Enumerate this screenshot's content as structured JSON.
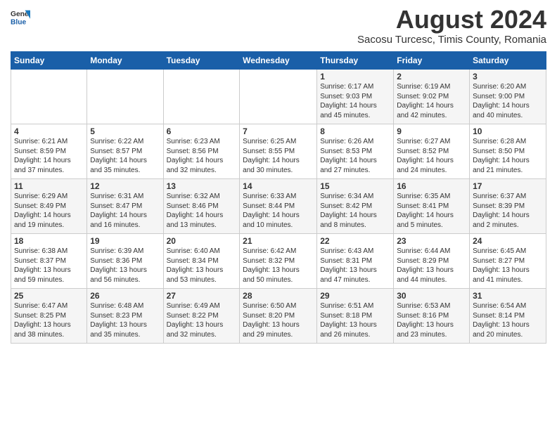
{
  "header": {
    "logo_general": "General",
    "logo_blue": "Blue",
    "title": "August 2024",
    "subtitle": "Sacosu Turcesc, Timis County, Romania"
  },
  "weekdays": [
    "Sunday",
    "Monday",
    "Tuesday",
    "Wednesday",
    "Thursday",
    "Friday",
    "Saturday"
  ],
  "weeks": [
    [
      {
        "day": "",
        "info": ""
      },
      {
        "day": "",
        "info": ""
      },
      {
        "day": "",
        "info": ""
      },
      {
        "day": "",
        "info": ""
      },
      {
        "day": "1",
        "info": "Sunrise: 6:17 AM\nSunset: 9:03 PM\nDaylight: 14 hours\nand 45 minutes."
      },
      {
        "day": "2",
        "info": "Sunrise: 6:19 AM\nSunset: 9:02 PM\nDaylight: 14 hours\nand 42 minutes."
      },
      {
        "day": "3",
        "info": "Sunrise: 6:20 AM\nSunset: 9:00 PM\nDaylight: 14 hours\nand 40 minutes."
      }
    ],
    [
      {
        "day": "4",
        "info": "Sunrise: 6:21 AM\nSunset: 8:59 PM\nDaylight: 14 hours\nand 37 minutes."
      },
      {
        "day": "5",
        "info": "Sunrise: 6:22 AM\nSunset: 8:57 PM\nDaylight: 14 hours\nand 35 minutes."
      },
      {
        "day": "6",
        "info": "Sunrise: 6:23 AM\nSunset: 8:56 PM\nDaylight: 14 hours\nand 32 minutes."
      },
      {
        "day": "7",
        "info": "Sunrise: 6:25 AM\nSunset: 8:55 PM\nDaylight: 14 hours\nand 30 minutes."
      },
      {
        "day": "8",
        "info": "Sunrise: 6:26 AM\nSunset: 8:53 PM\nDaylight: 14 hours\nand 27 minutes."
      },
      {
        "day": "9",
        "info": "Sunrise: 6:27 AM\nSunset: 8:52 PM\nDaylight: 14 hours\nand 24 minutes."
      },
      {
        "day": "10",
        "info": "Sunrise: 6:28 AM\nSunset: 8:50 PM\nDaylight: 14 hours\nand 21 minutes."
      }
    ],
    [
      {
        "day": "11",
        "info": "Sunrise: 6:29 AM\nSunset: 8:49 PM\nDaylight: 14 hours\nand 19 minutes."
      },
      {
        "day": "12",
        "info": "Sunrise: 6:31 AM\nSunset: 8:47 PM\nDaylight: 14 hours\nand 16 minutes."
      },
      {
        "day": "13",
        "info": "Sunrise: 6:32 AM\nSunset: 8:46 PM\nDaylight: 14 hours\nand 13 minutes."
      },
      {
        "day": "14",
        "info": "Sunrise: 6:33 AM\nSunset: 8:44 PM\nDaylight: 14 hours\nand 10 minutes."
      },
      {
        "day": "15",
        "info": "Sunrise: 6:34 AM\nSunset: 8:42 PM\nDaylight: 14 hours\nand 8 minutes."
      },
      {
        "day": "16",
        "info": "Sunrise: 6:35 AM\nSunset: 8:41 PM\nDaylight: 14 hours\nand 5 minutes."
      },
      {
        "day": "17",
        "info": "Sunrise: 6:37 AM\nSunset: 8:39 PM\nDaylight: 14 hours\nand 2 minutes."
      }
    ],
    [
      {
        "day": "18",
        "info": "Sunrise: 6:38 AM\nSunset: 8:37 PM\nDaylight: 13 hours\nand 59 minutes."
      },
      {
        "day": "19",
        "info": "Sunrise: 6:39 AM\nSunset: 8:36 PM\nDaylight: 13 hours\nand 56 minutes."
      },
      {
        "day": "20",
        "info": "Sunrise: 6:40 AM\nSunset: 8:34 PM\nDaylight: 13 hours\nand 53 minutes."
      },
      {
        "day": "21",
        "info": "Sunrise: 6:42 AM\nSunset: 8:32 PM\nDaylight: 13 hours\nand 50 minutes."
      },
      {
        "day": "22",
        "info": "Sunrise: 6:43 AM\nSunset: 8:31 PM\nDaylight: 13 hours\nand 47 minutes."
      },
      {
        "day": "23",
        "info": "Sunrise: 6:44 AM\nSunset: 8:29 PM\nDaylight: 13 hours\nand 44 minutes."
      },
      {
        "day": "24",
        "info": "Sunrise: 6:45 AM\nSunset: 8:27 PM\nDaylight: 13 hours\nand 41 minutes."
      }
    ],
    [
      {
        "day": "25",
        "info": "Sunrise: 6:47 AM\nSunset: 8:25 PM\nDaylight: 13 hours\nand 38 minutes."
      },
      {
        "day": "26",
        "info": "Sunrise: 6:48 AM\nSunset: 8:23 PM\nDaylight: 13 hours\nand 35 minutes."
      },
      {
        "day": "27",
        "info": "Sunrise: 6:49 AM\nSunset: 8:22 PM\nDaylight: 13 hours\nand 32 minutes."
      },
      {
        "day": "28",
        "info": "Sunrise: 6:50 AM\nSunset: 8:20 PM\nDaylight: 13 hours\nand 29 minutes."
      },
      {
        "day": "29",
        "info": "Sunrise: 6:51 AM\nSunset: 8:18 PM\nDaylight: 13 hours\nand 26 minutes."
      },
      {
        "day": "30",
        "info": "Sunrise: 6:53 AM\nSunset: 8:16 PM\nDaylight: 13 hours\nand 23 minutes."
      },
      {
        "day": "31",
        "info": "Sunrise: 6:54 AM\nSunset: 8:14 PM\nDaylight: 13 hours\nand 20 minutes."
      }
    ]
  ]
}
